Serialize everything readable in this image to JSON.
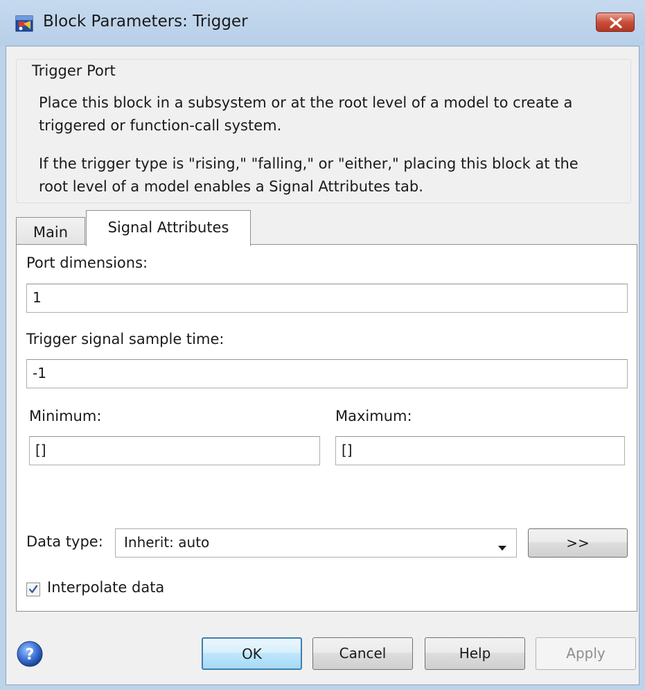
{
  "window": {
    "title": "Block Parameters: Trigger",
    "close_symbol": "✕"
  },
  "group": {
    "legend": "Trigger Port",
    "description_1_line_1": "Place this block in a subsystem or at the root level of a model to create a",
    "description_1_line_2": "triggered or function-call system.",
    "description_2_line_1": "If the trigger type is \"rising,\" \"falling,\" or \"either,\" placing this block at the",
    "description_2_line_2": "root level of a model enables a Signal Attributes tab."
  },
  "tabs": [
    {
      "label": "Main",
      "selected": false
    },
    {
      "label": "Signal Attributes",
      "selected": true
    }
  ],
  "form": {
    "port_dimensions_label": "Port dimensions:",
    "port_dimensions_value": "1",
    "sample_time_label": "Trigger signal sample time:",
    "sample_time_value": "-1",
    "minimum_label": "Minimum:",
    "minimum_value": "[]",
    "maximum_label": "Maximum:",
    "maximum_value": "[]",
    "data_type_label": "Data type:",
    "data_type_value": "Inherit: auto",
    "data_type_assistant_label": ">>",
    "interpolate_label": "Interpolate data",
    "interpolate_checked": true
  },
  "footer": {
    "ok_label": "OK",
    "cancel_label": "Cancel",
    "help_label": "Help",
    "apply_label": "Apply"
  },
  "icons": {
    "app": "simulink-block-icon",
    "close": "close-icon",
    "help": "help-icon",
    "dropdown": "chevron-down-icon",
    "check": "checkmark-icon"
  },
  "colors": {
    "title_bar": "#bcd3ea",
    "close_button": "#c9503c",
    "dialog_bg": "#f0f0f0",
    "default_button_border": "#3c7fb1"
  }
}
